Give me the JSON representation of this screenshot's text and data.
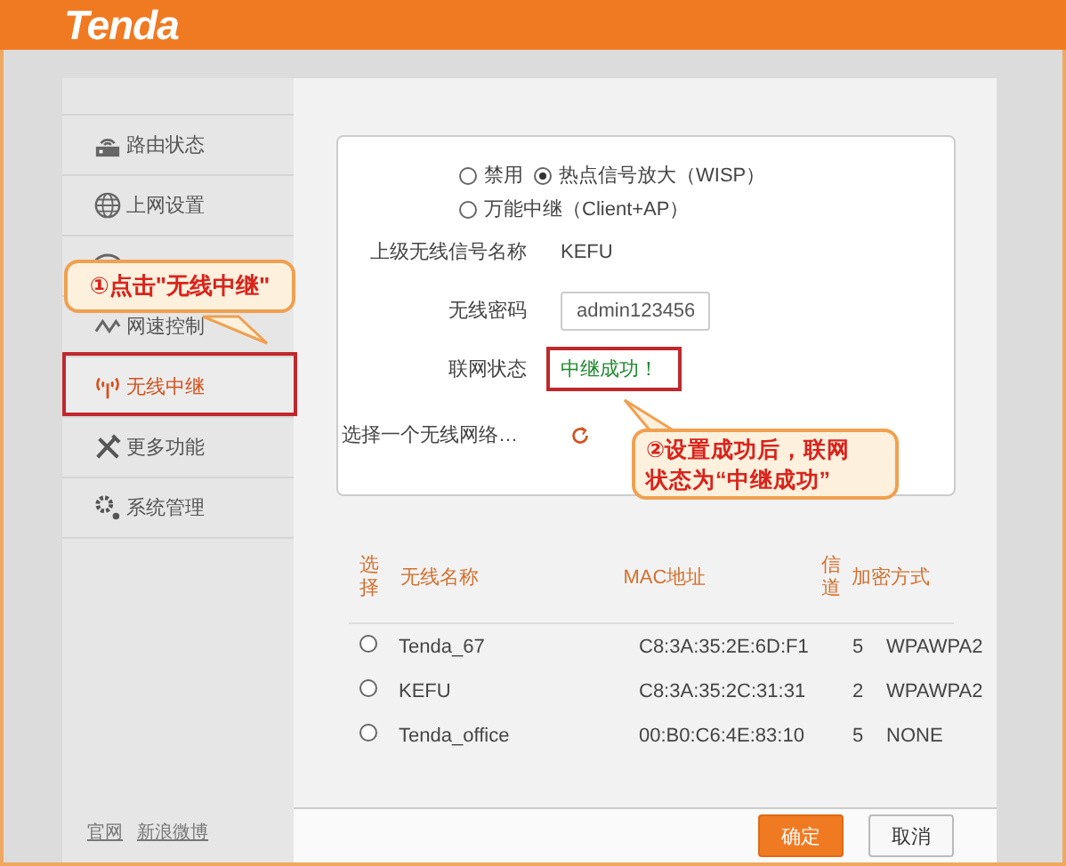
{
  "header": {
    "logo": "Tenda"
  },
  "sidebar": {
    "items": [
      {
        "label": "路由状态",
        "selected": false
      },
      {
        "label": "上网设置",
        "selected": false
      },
      {
        "label": "网速控制",
        "selected": false
      },
      {
        "label": "无线中继",
        "selected": true
      },
      {
        "label": "更多功能",
        "selected": false
      },
      {
        "label": "系统管理",
        "selected": false
      }
    ],
    "links": [
      "官网",
      "新浪微博"
    ]
  },
  "mode_options": [
    {
      "label": "禁用",
      "selected": false
    },
    {
      "label": "热点信号放大（WISP）",
      "selected": true
    },
    {
      "label": "万能中继（Client+AP）",
      "selected": false
    }
  ],
  "fields": [
    {
      "label": "上级无线信号名称",
      "kind": "text",
      "value": "KEFU"
    },
    {
      "label": "无线密码",
      "kind": "input",
      "value": "admin123456"
    },
    {
      "label": "联网状态",
      "kind": "status",
      "value": "中继成功！"
    }
  ],
  "scan": {
    "label": "选择一个无线网络…"
  },
  "table": {
    "columns": [
      "选择",
      "无线名称",
      "MAC地址",
      "信道",
      "加密方式"
    ],
    "rows": [
      {
        "name": "Tenda_67",
        "mac": "C8:3A:35:2E:6D:F1",
        "channel": "5",
        "encryption": "WPAWPA2",
        "selected": false
      },
      {
        "name": "KEFU",
        "mac": "C8:3A:35:2C:31:31",
        "channel": "2",
        "encryption": "WPAWPA2",
        "selected": false
      },
      {
        "name": "Tenda_office",
        "mac": "00:B0:C6:4E:83:10",
        "channel": "5",
        "encryption": "NONE",
        "selected": false
      }
    ]
  },
  "buttons": [
    {
      "label": "确定",
      "kind": "primary"
    },
    {
      "label": "取消",
      "kind": "secondary"
    }
  ],
  "annotations": [
    {
      "lines": [
        "①点击\"无线中继\""
      ]
    },
    {
      "lines": [
        "②设置成功后，联网",
        "状态为“中继成功”"
      ]
    }
  ]
}
